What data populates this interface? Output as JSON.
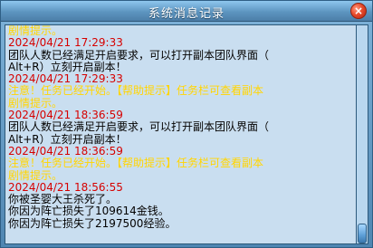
{
  "window": {
    "title": "系统消息记录",
    "close_label": "×"
  },
  "log": [
    {
      "text": "剧情提示。",
      "color": "#ffd400"
    },
    {
      "text": "2024/04/21 17:29:33",
      "color": "#d40000"
    },
    {
      "text": "团队人数已经满足开启要求，可以打开副本团队界面（",
      "color": "#000000"
    },
    {
      "text": "Alt+R）立刻开启副本！",
      "color": "#000000"
    },
    {
      "text": "2024/04/21 17:29:33",
      "color": "#d40000"
    },
    {
      "text": "注意！任务已经开始。【帮助提示】任务栏可查看副本",
      "color": "#ffd400"
    },
    {
      "text": "剧情提示。",
      "color": "#ffd400"
    },
    {
      "text": "2024/04/21 18:36:59",
      "color": "#d40000"
    },
    {
      "text": "团队人数已经满足开启要求，可以打开副本团队界面（",
      "color": "#000000"
    },
    {
      "text": "Alt+R）立刻开启副本！",
      "color": "#000000"
    },
    {
      "text": "2024/04/21 18:36:59",
      "color": "#d40000"
    },
    {
      "text": "注意！任务已经开始。【帮助提示】任务栏可查看副本",
      "color": "#ffd400"
    },
    {
      "text": "剧情提示。",
      "color": "#ffd400"
    },
    {
      "text": "2024/04/21 18:56:55",
      "color": "#d40000"
    },
    {
      "text": "你被圣婴大王杀死了。",
      "color": "#000000"
    },
    {
      "text": "你因为阵亡损失了109614金钱。",
      "color": "#000000"
    },
    {
      "text": "你因为阵亡损失了2197500经验。",
      "color": "#000000"
    }
  ],
  "scrollbar": {
    "position": 1.0
  }
}
